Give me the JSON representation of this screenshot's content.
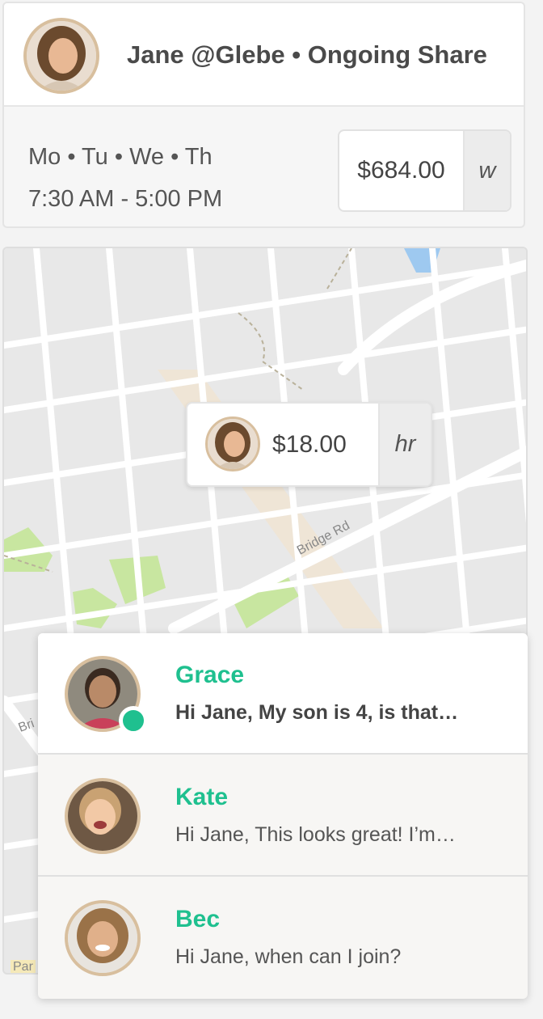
{
  "share": {
    "title": "Jane @Glebe • Ongoing Share",
    "days": "Mo • Tu • We • Th",
    "hours": "7:30 AM - 5:00 PM",
    "price": "$684.00",
    "price_unit": "w"
  },
  "map": {
    "road_label": "Bridge Rd",
    "partial_labels": [
      "Bri",
      "Par"
    ],
    "pin": {
      "price": "$18.00",
      "unit": "hr"
    }
  },
  "messages": [
    {
      "name": "Grace",
      "preview": "Hi Jane, My son is 4, is that…",
      "unread": true,
      "online": true
    },
    {
      "name": "Kate",
      "preview": "Hi Jane, This looks great! I’m…",
      "unread": false,
      "online": false
    },
    {
      "name": "Bec",
      "preview": "Hi Jane, when can I join?",
      "unread": false,
      "online": false
    }
  ],
  "colors": {
    "accent": "#1fc08f",
    "avatar_ring": "#d8bf9e",
    "park": "#c8e6a0",
    "water": "#9ec9f0",
    "road": "#ffffff",
    "map_bg": "#e8e8e8"
  }
}
